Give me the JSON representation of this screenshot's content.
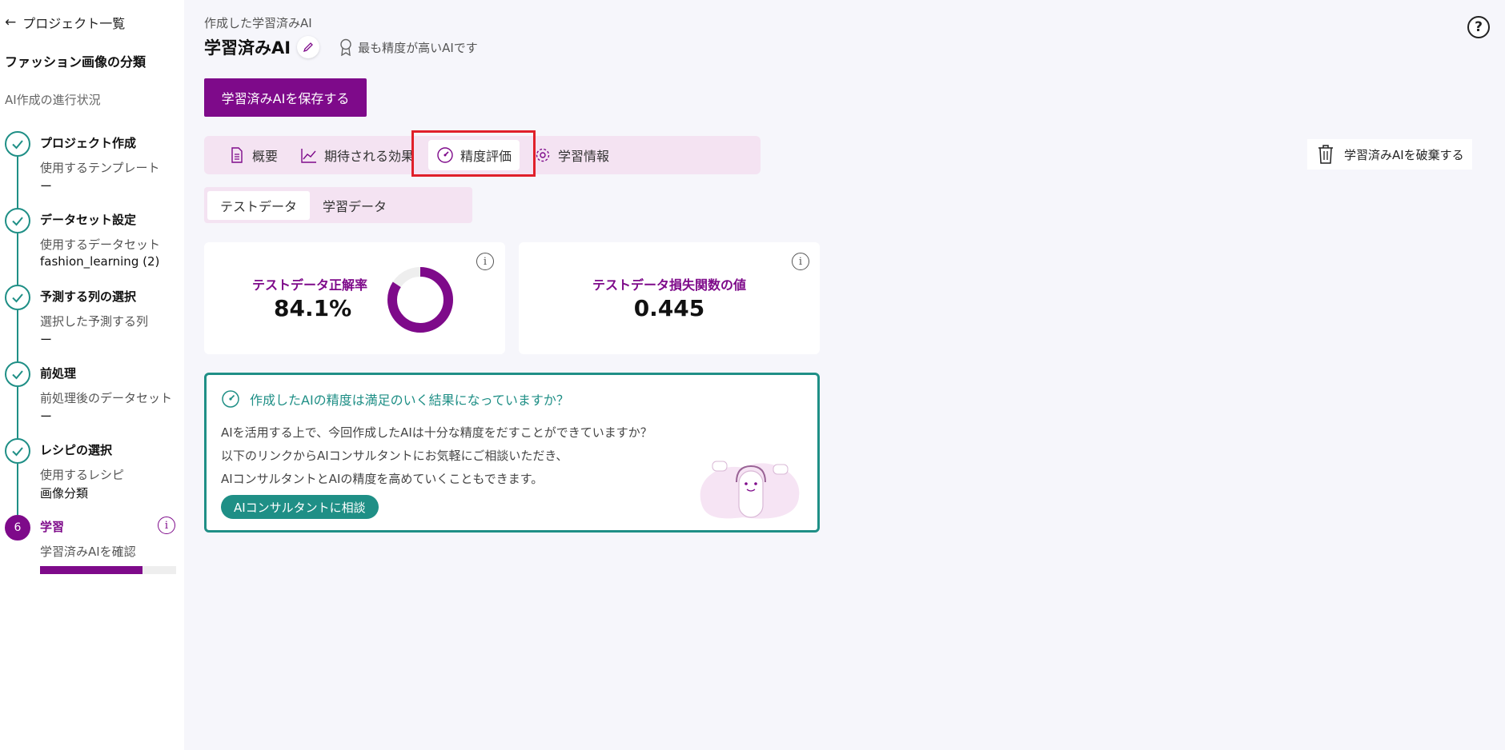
{
  "sidebar": {
    "back_label": "プロジェクト一覧",
    "project_name": "ファッション画像の分類",
    "progress_title": "AI作成の進行状況",
    "steps": [
      {
        "title": "プロジェクト作成",
        "sub": "使用するテンプレート",
        "value": "ー"
      },
      {
        "title": "データセット設定",
        "sub": "使用するデータセット",
        "value": "fashion_learning (2)"
      },
      {
        "title": "予測する列の選択",
        "sub": "選択した予測する列",
        "value": "ー"
      },
      {
        "title": "前処理",
        "sub": "前処理後のデータセット",
        "value": "ー"
      },
      {
        "title": "レシピの選択",
        "sub": "使用するレシピ",
        "value": "画像分類"
      },
      {
        "number": "6",
        "title": "学習",
        "sub": "学習済みAIを確認",
        "progress": 0.75
      }
    ]
  },
  "header": {
    "crumb": "作成した学習済みAI",
    "model_name": "学習済みAI",
    "best_label": "最も精度が高いAIです",
    "help_label": "?"
  },
  "save_label": "学習済みAIを保存する",
  "discard_label": "学習済みAIを破棄する",
  "tabs": [
    {
      "label": "概要"
    },
    {
      "label": "期待される効果"
    },
    {
      "label": "精度評価"
    },
    {
      "label": "学習情報"
    }
  ],
  "subtabs": [
    {
      "label": "テストデータ"
    },
    {
      "label": "学習データ"
    }
  ],
  "cards": {
    "accuracy": {
      "label": "テストデータ正解率",
      "value": "84.1%",
      "fraction": 0.841
    },
    "loss": {
      "label": "テストデータ損失関数の値",
      "value": "0.445"
    }
  },
  "consult": {
    "heading": "作成したAIの精度は満足のいく結果になっていますか？",
    "lines": [
      "AIを活用する上で、今回作成したAIは十分な精度をだすことができていますか？",
      "以下のリンクからAIコンサルタントにお気軽にご相談いただき、",
      "AIコンサルタントとAIの精度を高めていくこともできます。"
    ],
    "button": "AIコンサルタントに相談"
  },
  "colors": {
    "brand": "#7e0a8a",
    "teal": "#1f8f86",
    "tab_bg": "#f4e3f2",
    "highlight": "#e0202a"
  }
}
